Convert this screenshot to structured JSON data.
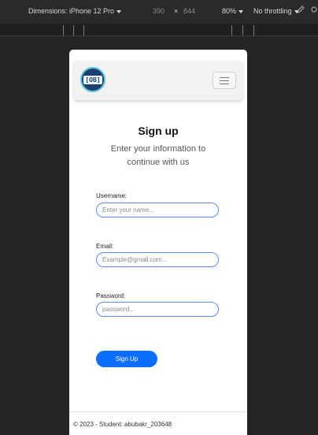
{
  "devtools": {
    "dimensions_label": "Dimensions: iPhone 12 Pro",
    "width": "390",
    "times": "×",
    "height": "844",
    "zoom": "80%",
    "throttling": "No throttling"
  },
  "navbar": {
    "logo_text": "[OB]"
  },
  "form": {
    "title": "Sign up",
    "subtitle": "Enter your information to continue with us",
    "username_label": "Username:",
    "username_placeholder": "Enter your name...",
    "email_label": "Email:",
    "email_placeholder": "Example@gmail.com...",
    "password_label": "Password:",
    "password_placeholder": "password...",
    "submit_label": "Sign Up"
  },
  "footer": {
    "text": "© 2023 - Student: abubakr_203648"
  },
  "colors": {
    "accent": "#0d6efd",
    "input_border": "#5b8de8",
    "devtools_bg": "#242424"
  }
}
